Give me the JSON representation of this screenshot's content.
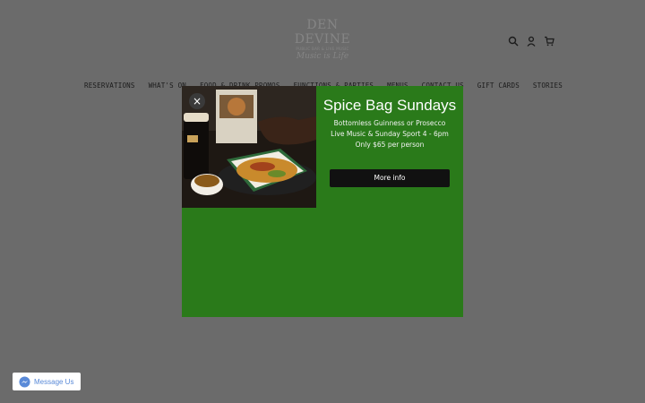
{
  "header": {
    "logo": {
      "name": "DEN DEVINE",
      "sub": "PUBLIC BAR & LIVE MUSIC",
      "script": "Music is Life"
    },
    "icons": [
      "search-icon",
      "account-icon",
      "cart-icon"
    ]
  },
  "nav": {
    "items": [
      {
        "label": "RESERVATIONS"
      },
      {
        "label": "WHAT'S ON"
      },
      {
        "label": "FOOD & DRINK PROMOS"
      },
      {
        "label": "FUNCTIONS & PARTIES"
      },
      {
        "label": "MENUS"
      },
      {
        "label": "CONTACT US"
      },
      {
        "label": "GIFT CARDS"
      },
      {
        "label": "STORIES"
      }
    ]
  },
  "popup": {
    "close_label": "×",
    "title": "Spice Bag Sundays",
    "lines": [
      "Bottomless Guinness or Prosecco",
      "Live Music & Sunday Sport 4 - 6pm",
      "Only $65 per person"
    ],
    "cta_label": "More info",
    "background": "#2a7a1a"
  },
  "messenger": {
    "label": "Message Us",
    "accent": "#5a8ad8"
  }
}
